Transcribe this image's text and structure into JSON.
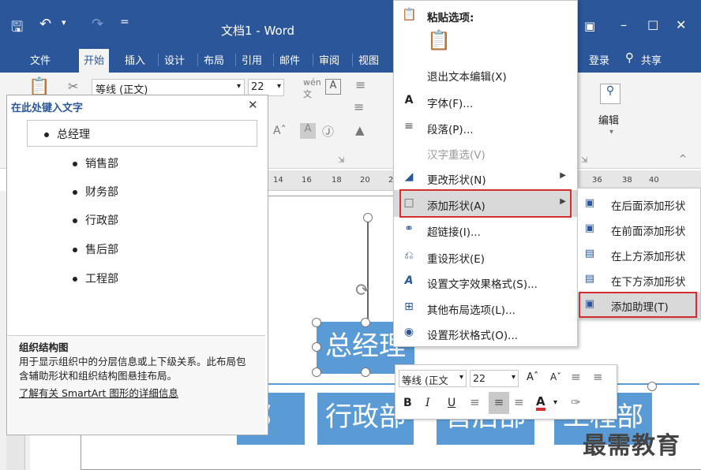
{
  "window": {
    "title": "文档1 - Word",
    "quick_access": {
      "save": "save-icon",
      "undo": "undo-icon",
      "redo": "redo-icon",
      "customize": "customize-icon"
    },
    "controls": {
      "restore": "ribbon-display-icon",
      "minimize": "minimize-icon",
      "maximize": "maximize-icon",
      "close": "close-icon"
    },
    "signin": "登录",
    "share": "共享"
  },
  "tabs": [
    "文件",
    "开始",
    "插入",
    "设计",
    "布局",
    "引用",
    "邮件",
    "审阅",
    "视图"
  ],
  "active_tab": "开始",
  "ribbon": {
    "font_name": "等线 (正文)",
    "font_size": "22",
    "edit_group": "编辑"
  },
  "ruler_ticks": [
    "14",
    "16",
    "18",
    "20",
    "2",
    "36",
    "38",
    "40"
  ],
  "text_pane": {
    "title": "在此处键入文字",
    "items": [
      {
        "text": "总经理",
        "level": 1
      },
      {
        "text": "销售部",
        "level": 2
      },
      {
        "text": "财务部",
        "level": 2
      },
      {
        "text": "行政部",
        "level": 2
      },
      {
        "text": "售后部",
        "level": 2
      },
      {
        "text": "工程部",
        "level": 2
      }
    ],
    "desc_title": "组织结构图",
    "desc_body": "用于显示组织中的分层信息或上下级关系。此布局包含辅助形状和组织结构图悬挂布局。",
    "desc_link": "了解有关 SmartArt 图形的详细信息"
  },
  "diagram": {
    "top_shape": "总经理",
    "bottom_shapes": [
      "部",
      "行政部",
      "售后部",
      "工程部"
    ]
  },
  "context_menu": {
    "paste_header": "粘贴选项:",
    "items": [
      {
        "label": "退出文本编辑(X)",
        "icon": "",
        "disabled": false,
        "submenu": false
      },
      {
        "label": "字体(F)...",
        "icon": "font-icon",
        "disabled": false,
        "submenu": false
      },
      {
        "label": "段落(P)...",
        "icon": "paragraph-icon",
        "disabled": false,
        "submenu": false
      },
      {
        "label": "汉字重选(V)",
        "icon": "",
        "disabled": true,
        "submenu": false
      },
      {
        "label": "更改形状(N)",
        "icon": "change-shape-icon",
        "disabled": false,
        "submenu": true
      },
      {
        "label": "添加形状(A)",
        "icon": "add-shape-icon",
        "disabled": false,
        "submenu": true,
        "highlighted": true
      },
      {
        "label": "超链接(I)...",
        "icon": "hyperlink-icon",
        "disabled": false,
        "submenu": false
      },
      {
        "label": "重设形状(E)",
        "icon": "reset-shape-icon",
        "disabled": false,
        "submenu": false
      },
      {
        "label": "设置文字效果格式(S)...",
        "icon": "text-effects-icon",
        "disabled": false,
        "submenu": false
      },
      {
        "label": "其他布局选项(L)...",
        "icon": "layout-options-icon",
        "disabled": false,
        "submenu": false
      },
      {
        "label": "设置形状格式(O)...",
        "icon": "format-shape-icon",
        "disabled": false,
        "submenu": false
      }
    ]
  },
  "submenu": {
    "items": [
      {
        "label": "在后面添加形状"
      },
      {
        "label": "在前面添加形状"
      },
      {
        "label": "在上方添加形状"
      },
      {
        "label": "在下方添加形状"
      },
      {
        "label": "添加助理(T)",
        "highlighted": true
      }
    ]
  },
  "mini_toolbar": {
    "font_name": "等线 (正文",
    "font_size": "22",
    "bold": "B",
    "italic": "I",
    "underline": "U",
    "font_color": "A"
  },
  "watermark": "最需教育",
  "colors": {
    "accent": "#2b579a",
    "shape": "#5b9bd5",
    "highlight_border": "#d32f2f"
  }
}
